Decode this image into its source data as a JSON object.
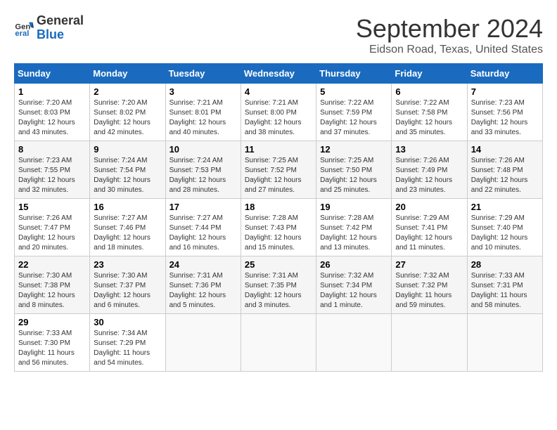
{
  "header": {
    "logo_line1": "General",
    "logo_line2": "Blue",
    "month_title": "September 2024",
    "subtitle": "Eidson Road, Texas, United States"
  },
  "days_of_week": [
    "Sunday",
    "Monday",
    "Tuesday",
    "Wednesday",
    "Thursday",
    "Friday",
    "Saturday"
  ],
  "weeks": [
    [
      {
        "num": "1",
        "sunrise": "7:20 AM",
        "sunset": "8:03 PM",
        "daylight": "12 hours and 43 minutes."
      },
      {
        "num": "2",
        "sunrise": "7:20 AM",
        "sunset": "8:02 PM",
        "daylight": "12 hours and 42 minutes."
      },
      {
        "num": "3",
        "sunrise": "7:21 AM",
        "sunset": "8:01 PM",
        "daylight": "12 hours and 40 minutes."
      },
      {
        "num": "4",
        "sunrise": "7:21 AM",
        "sunset": "8:00 PM",
        "daylight": "12 hours and 38 minutes."
      },
      {
        "num": "5",
        "sunrise": "7:22 AM",
        "sunset": "7:59 PM",
        "daylight": "12 hours and 37 minutes."
      },
      {
        "num": "6",
        "sunrise": "7:22 AM",
        "sunset": "7:58 PM",
        "daylight": "12 hours and 35 minutes."
      },
      {
        "num": "7",
        "sunrise": "7:23 AM",
        "sunset": "7:56 PM",
        "daylight": "12 hours and 33 minutes."
      }
    ],
    [
      {
        "num": "8",
        "sunrise": "7:23 AM",
        "sunset": "7:55 PM",
        "daylight": "12 hours and 32 minutes."
      },
      {
        "num": "9",
        "sunrise": "7:24 AM",
        "sunset": "7:54 PM",
        "daylight": "12 hours and 30 minutes."
      },
      {
        "num": "10",
        "sunrise": "7:24 AM",
        "sunset": "7:53 PM",
        "daylight": "12 hours and 28 minutes."
      },
      {
        "num": "11",
        "sunrise": "7:25 AM",
        "sunset": "7:52 PM",
        "daylight": "12 hours and 27 minutes."
      },
      {
        "num": "12",
        "sunrise": "7:25 AM",
        "sunset": "7:50 PM",
        "daylight": "12 hours and 25 minutes."
      },
      {
        "num": "13",
        "sunrise": "7:26 AM",
        "sunset": "7:49 PM",
        "daylight": "12 hours and 23 minutes."
      },
      {
        "num": "14",
        "sunrise": "7:26 AM",
        "sunset": "7:48 PM",
        "daylight": "12 hours and 22 minutes."
      }
    ],
    [
      {
        "num": "15",
        "sunrise": "7:26 AM",
        "sunset": "7:47 PM",
        "daylight": "12 hours and 20 minutes."
      },
      {
        "num": "16",
        "sunrise": "7:27 AM",
        "sunset": "7:46 PM",
        "daylight": "12 hours and 18 minutes."
      },
      {
        "num": "17",
        "sunrise": "7:27 AM",
        "sunset": "7:44 PM",
        "daylight": "12 hours and 16 minutes."
      },
      {
        "num": "18",
        "sunrise": "7:28 AM",
        "sunset": "7:43 PM",
        "daylight": "12 hours and 15 minutes."
      },
      {
        "num": "19",
        "sunrise": "7:28 AM",
        "sunset": "7:42 PM",
        "daylight": "12 hours and 13 minutes."
      },
      {
        "num": "20",
        "sunrise": "7:29 AM",
        "sunset": "7:41 PM",
        "daylight": "12 hours and 11 minutes."
      },
      {
        "num": "21",
        "sunrise": "7:29 AM",
        "sunset": "7:40 PM",
        "daylight": "12 hours and 10 minutes."
      }
    ],
    [
      {
        "num": "22",
        "sunrise": "7:30 AM",
        "sunset": "7:38 PM",
        "daylight": "12 hours and 8 minutes."
      },
      {
        "num": "23",
        "sunrise": "7:30 AM",
        "sunset": "7:37 PM",
        "daylight": "12 hours and 6 minutes."
      },
      {
        "num": "24",
        "sunrise": "7:31 AM",
        "sunset": "7:36 PM",
        "daylight": "12 hours and 5 minutes."
      },
      {
        "num": "25",
        "sunrise": "7:31 AM",
        "sunset": "7:35 PM",
        "daylight": "12 hours and 3 minutes."
      },
      {
        "num": "26",
        "sunrise": "7:32 AM",
        "sunset": "7:34 PM",
        "daylight": "12 hours and 1 minute."
      },
      {
        "num": "27",
        "sunrise": "7:32 AM",
        "sunset": "7:32 PM",
        "daylight": "11 hours and 59 minutes."
      },
      {
        "num": "28",
        "sunrise": "7:33 AM",
        "sunset": "7:31 PM",
        "daylight": "11 hours and 58 minutes."
      }
    ],
    [
      {
        "num": "29",
        "sunrise": "7:33 AM",
        "sunset": "7:30 PM",
        "daylight": "11 hours and 56 minutes."
      },
      {
        "num": "30",
        "sunrise": "7:34 AM",
        "sunset": "7:29 PM",
        "daylight": "11 hours and 54 minutes."
      },
      null,
      null,
      null,
      null,
      null
    ]
  ]
}
